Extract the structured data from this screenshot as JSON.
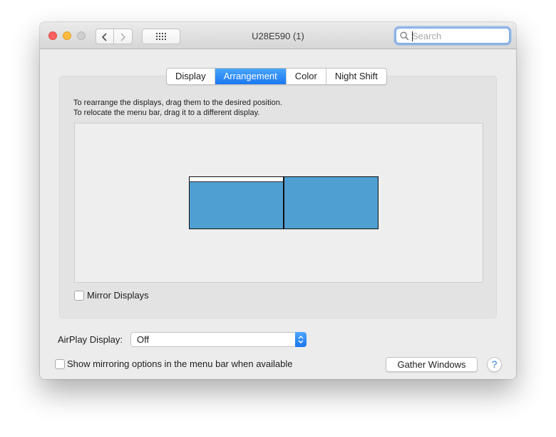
{
  "window": {
    "title": "U28E590 (1)",
    "search": {
      "placeholder": "Search",
      "value": ""
    }
  },
  "tabs": [
    {
      "label": "Display",
      "active": false
    },
    {
      "label": "Arrangement",
      "active": true
    },
    {
      "label": "Color",
      "active": false
    },
    {
      "label": "Night Shift",
      "active": false
    }
  ],
  "arrangement": {
    "instruction_line1": "To rearrange the displays, drag them to the desired position.",
    "instruction_line2": "To relocate the menu bar, drag it to a different display.",
    "displays": [
      {
        "has_menu_bar": true
      },
      {
        "has_menu_bar": false
      }
    ],
    "mirror_displays": {
      "label": "Mirror Displays",
      "checked": false
    }
  },
  "airplay": {
    "label": "AirPlay Display:",
    "value": "Off"
  },
  "show_mirroring": {
    "label": "Show mirroring options in the menu bar when available",
    "checked": false
  },
  "gather_windows_label": "Gather Windows",
  "help_label": "?",
  "colors": {
    "accent": "#1a78f0",
    "display_fill": "#4f9fd2",
    "close": "#fc605c",
    "minimize": "#fdbc40",
    "zoom_inactive": "#cfcfcf"
  }
}
